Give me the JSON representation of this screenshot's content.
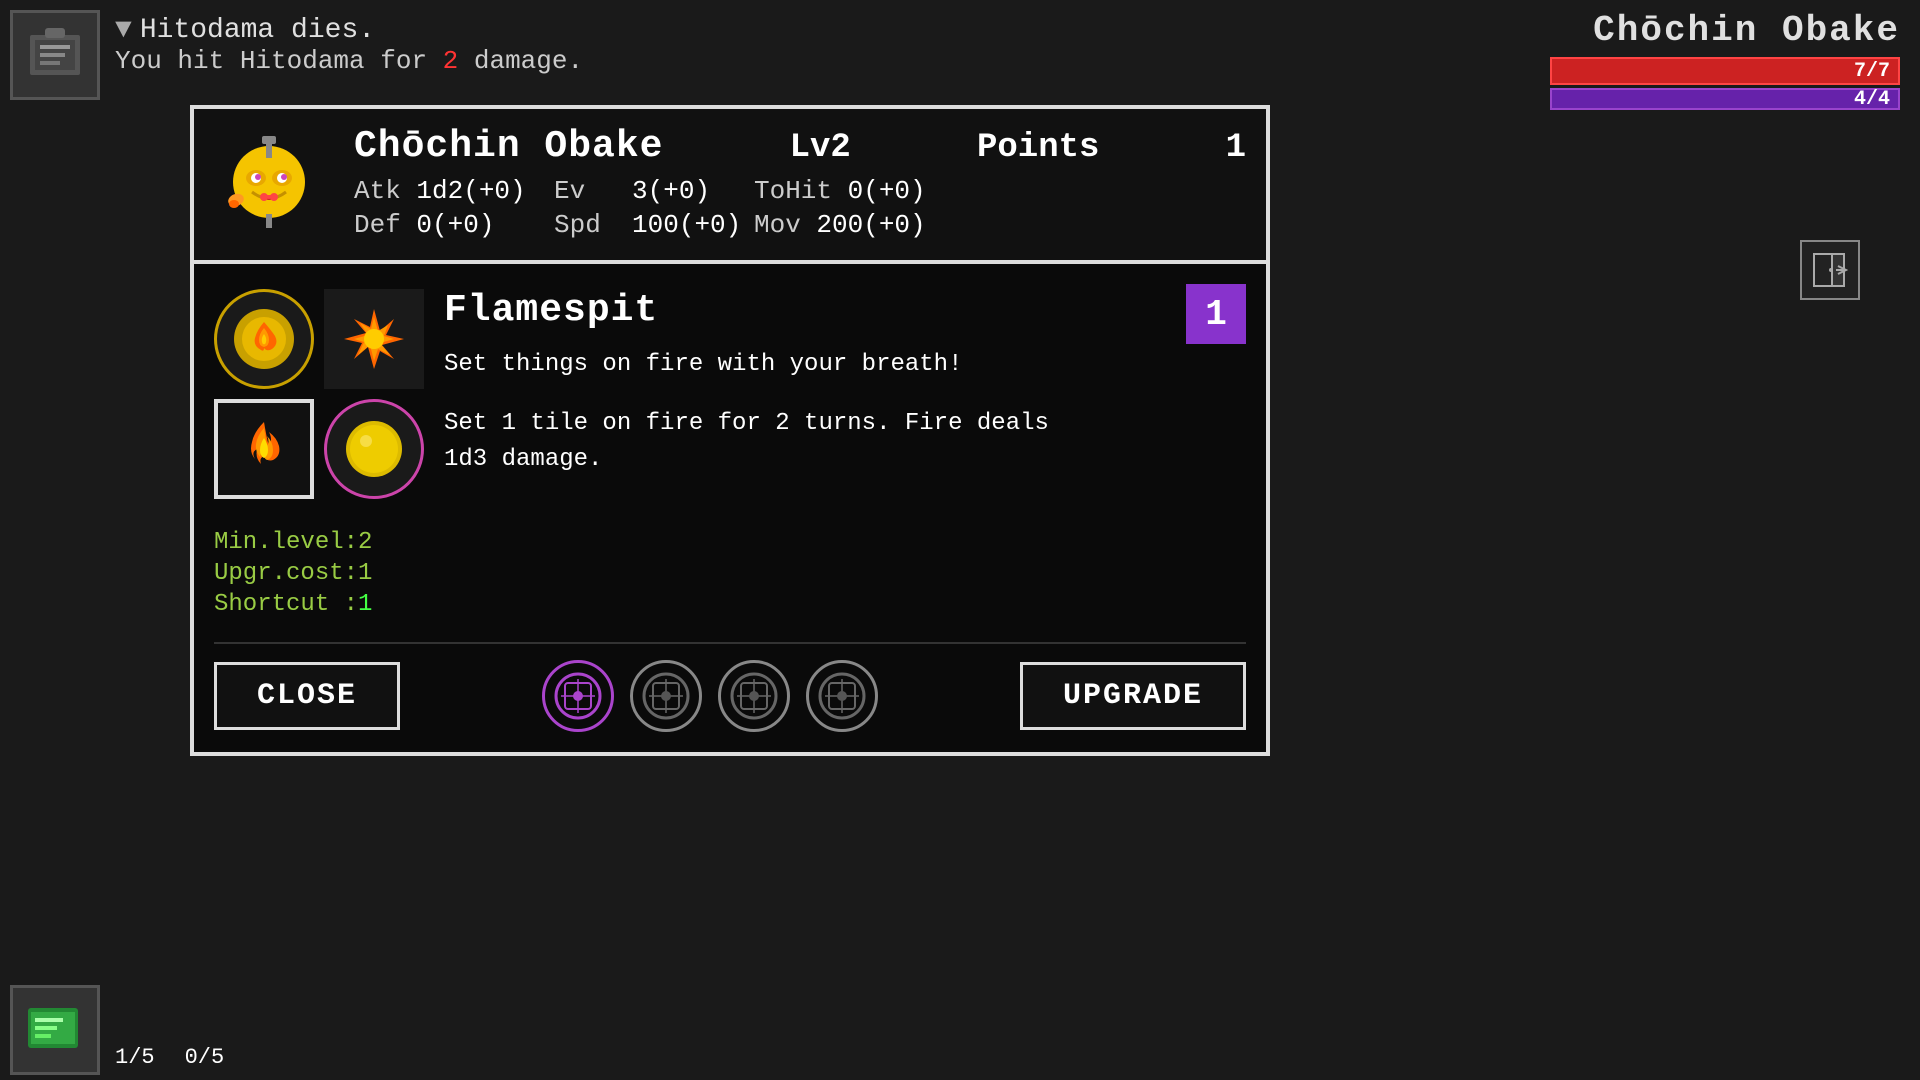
{
  "game": {
    "bg_color": "#111111"
  },
  "top_left": {
    "icon_label": "item-icon"
  },
  "top_right": {
    "character_name": "Chōchin Obake",
    "health_current": "7",
    "health_max": "7",
    "health_display": "7/7",
    "mana_current": "4",
    "mana_max": "4",
    "mana_display": "4/4"
  },
  "combat_log": {
    "line1_arrow": "▼",
    "line1_text": "Hitodama dies.",
    "line2_prefix": "You hit Hitodama for ",
    "line2_damage": "2",
    "line2_suffix": " damage."
  },
  "char_stats": {
    "name": "Chōchin Obake",
    "level_label": "Lv",
    "level_value": "2",
    "points_label": "Points",
    "points_value": "1",
    "atk_label": "Atk",
    "atk_value": "1d2(+0)",
    "ev_label": "Ev",
    "ev_value": "3(+0)",
    "tohit_label": "ToHit",
    "tohit_value": "0(+0)",
    "def_label": "Def",
    "def_value": "0(+0)",
    "spd_label": "Spd",
    "spd_value": "100(+0)",
    "mov_label": "Mov",
    "mov_value": "200(+0)"
  },
  "skill": {
    "name": "Flamespit",
    "level_badge": "1",
    "desc_short": "Set things on fire with your breath!",
    "desc_long_line1": "Set 1 tile on fire for 2 turns. Fire deals",
    "desc_long_line2": "1d3 damage.",
    "min_level_label": "Min.level:",
    "min_level_value": "2",
    "upgr_cost_label": "Upgr.cost:",
    "upgr_cost_value": "1",
    "shortcut_label": "Shortcut :",
    "shortcut_value": "1"
  },
  "buttons": {
    "close_label": "CLOSE",
    "upgrade_label": "UPGRADE"
  },
  "bottom_status": {
    "slot1": "1/5",
    "slot2": "0/5"
  },
  "slots": [
    {
      "active": true,
      "label": "slot-1"
    },
    {
      "active": false,
      "label": "slot-2"
    },
    {
      "active": false,
      "label": "slot-3"
    },
    {
      "active": false,
      "label": "slot-4"
    }
  ]
}
